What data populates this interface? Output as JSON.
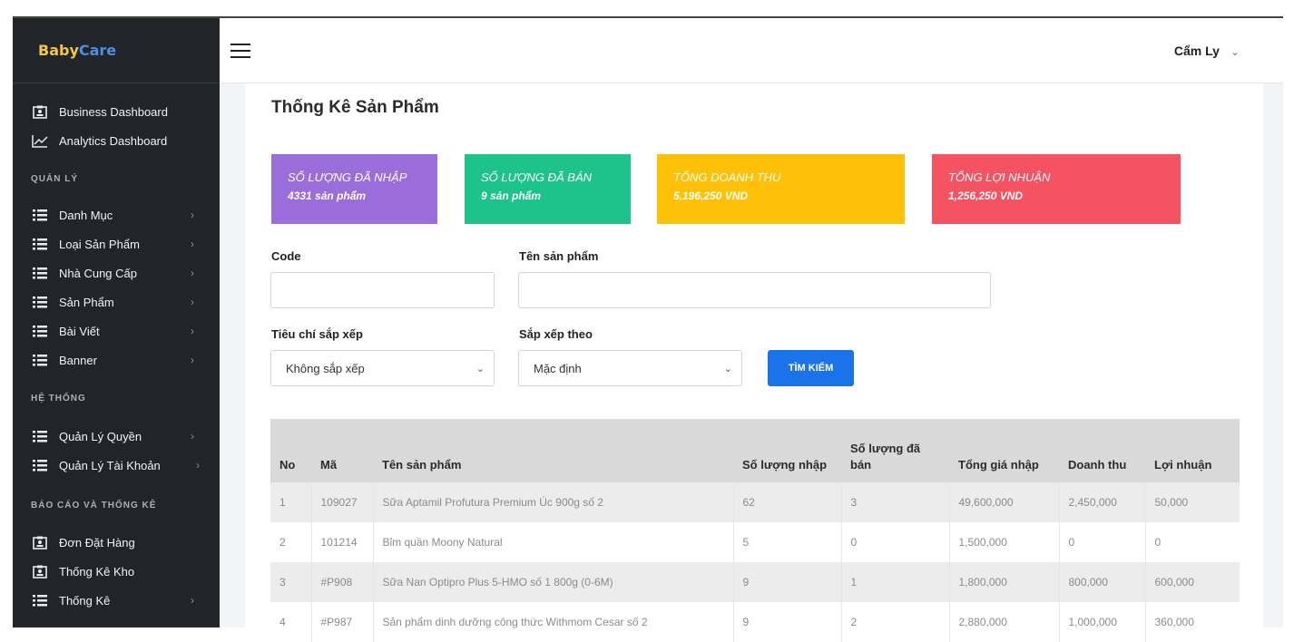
{
  "brand": {
    "part1": "Baby",
    "part2": "Care"
  },
  "sidebar": {
    "top_items": [
      {
        "label": "Business Dashboard",
        "icon": "id-card-icon"
      },
      {
        "label": "Analytics Dashboard",
        "icon": "line-chart-icon"
      }
    ],
    "sections": {
      "quan_ly": "QUẢN LÝ",
      "he_thong": "HỆ THỐNG",
      "bao_cao": "BÁO CÁO VÀ THỐNG KÊ"
    },
    "manage_items": [
      {
        "label": "Danh Mục",
        "icon": "list-icon"
      },
      {
        "label": "Loại Sản Phẩm",
        "icon": "list-icon"
      },
      {
        "label": "Nhà Cung Cấp",
        "icon": "list-icon"
      },
      {
        "label": "Sản Phẩm",
        "icon": "list-icon"
      },
      {
        "label": "Bài Viết",
        "icon": "list-icon"
      },
      {
        "label": "Banner",
        "icon": "list-icon"
      }
    ],
    "system_items": [
      {
        "label": "Quản Lý Quyền",
        "icon": "list-icon"
      },
      {
        "label": "Quản Lý Tài Khoản",
        "icon": "list-icon"
      }
    ],
    "report_items": [
      {
        "label": "Đơn Đặt Hàng",
        "icon": "id-card-icon"
      },
      {
        "label": "Thống Kê Kho",
        "icon": "id-card-icon"
      },
      {
        "label": "Thống Kê",
        "icon": "list-icon"
      }
    ],
    "chevron": "›"
  },
  "header": {
    "user_name": "Cẩm Ly",
    "caret": "⌄"
  },
  "page": {
    "title": "Thống Kê Sản Phẩm"
  },
  "stats": [
    {
      "label": "SỐ LƯỢNG ĐÃ NHẬP",
      "value": "4331 sản phẩm",
      "color": "#9b6ddb"
    },
    {
      "label": "SỐ LƯỢNG ĐÃ BÁN",
      "value": "9 sản phẩm",
      "color": "#1ec28b"
    },
    {
      "label": "TỔNG DOANH THU",
      "value": "5,196,250 VND",
      "color": "#ffc107"
    },
    {
      "label": "TỔNG LỢI NHUẬN",
      "value": "1,256,250 VND",
      "color": "#f55262"
    }
  ],
  "filters": {
    "code_label": "Code",
    "code_value": "",
    "name_label": "Tên sản phẩm",
    "name_value": "",
    "sort_criteria_label": "Tiêu chí sắp xếp",
    "sort_criteria_value": "Không sắp xếp",
    "sort_by_label": "Sắp xếp theo",
    "sort_by_value": "Mặc định",
    "search_button": "TÌM KIẾM"
  },
  "table": {
    "headers": [
      "No",
      "Mã",
      "Tên sản phẩm",
      "Số lượng nhập",
      "Số lượng đã bán",
      "Tổng giá nhập",
      "Doanh thu",
      "Lợi nhuận"
    ],
    "rows": [
      [
        "1",
        "109027",
        "Sữa Aptamil Profutura Premium Úc 900g số 2",
        "62",
        "3",
        "49,600,000",
        "2,450,000",
        "50,000"
      ],
      [
        "2",
        "101214",
        "Bỉm quần Moony Natural",
        "5",
        "0",
        "1,500,000",
        "0",
        "0"
      ],
      [
        "3",
        "#P908",
        "Sữa Nan Optipro Plus 5-HMO số 1 800g (0-6M)",
        "9",
        "1",
        "1,800,000",
        "800,000",
        "600,000"
      ],
      [
        "4",
        "#P987",
        "Sản phẩm dinh dưỡng công thức Withmom Cesar số 2",
        "9",
        "2",
        "2,880,000",
        "1,000,000",
        "360,000"
      ]
    ]
  }
}
